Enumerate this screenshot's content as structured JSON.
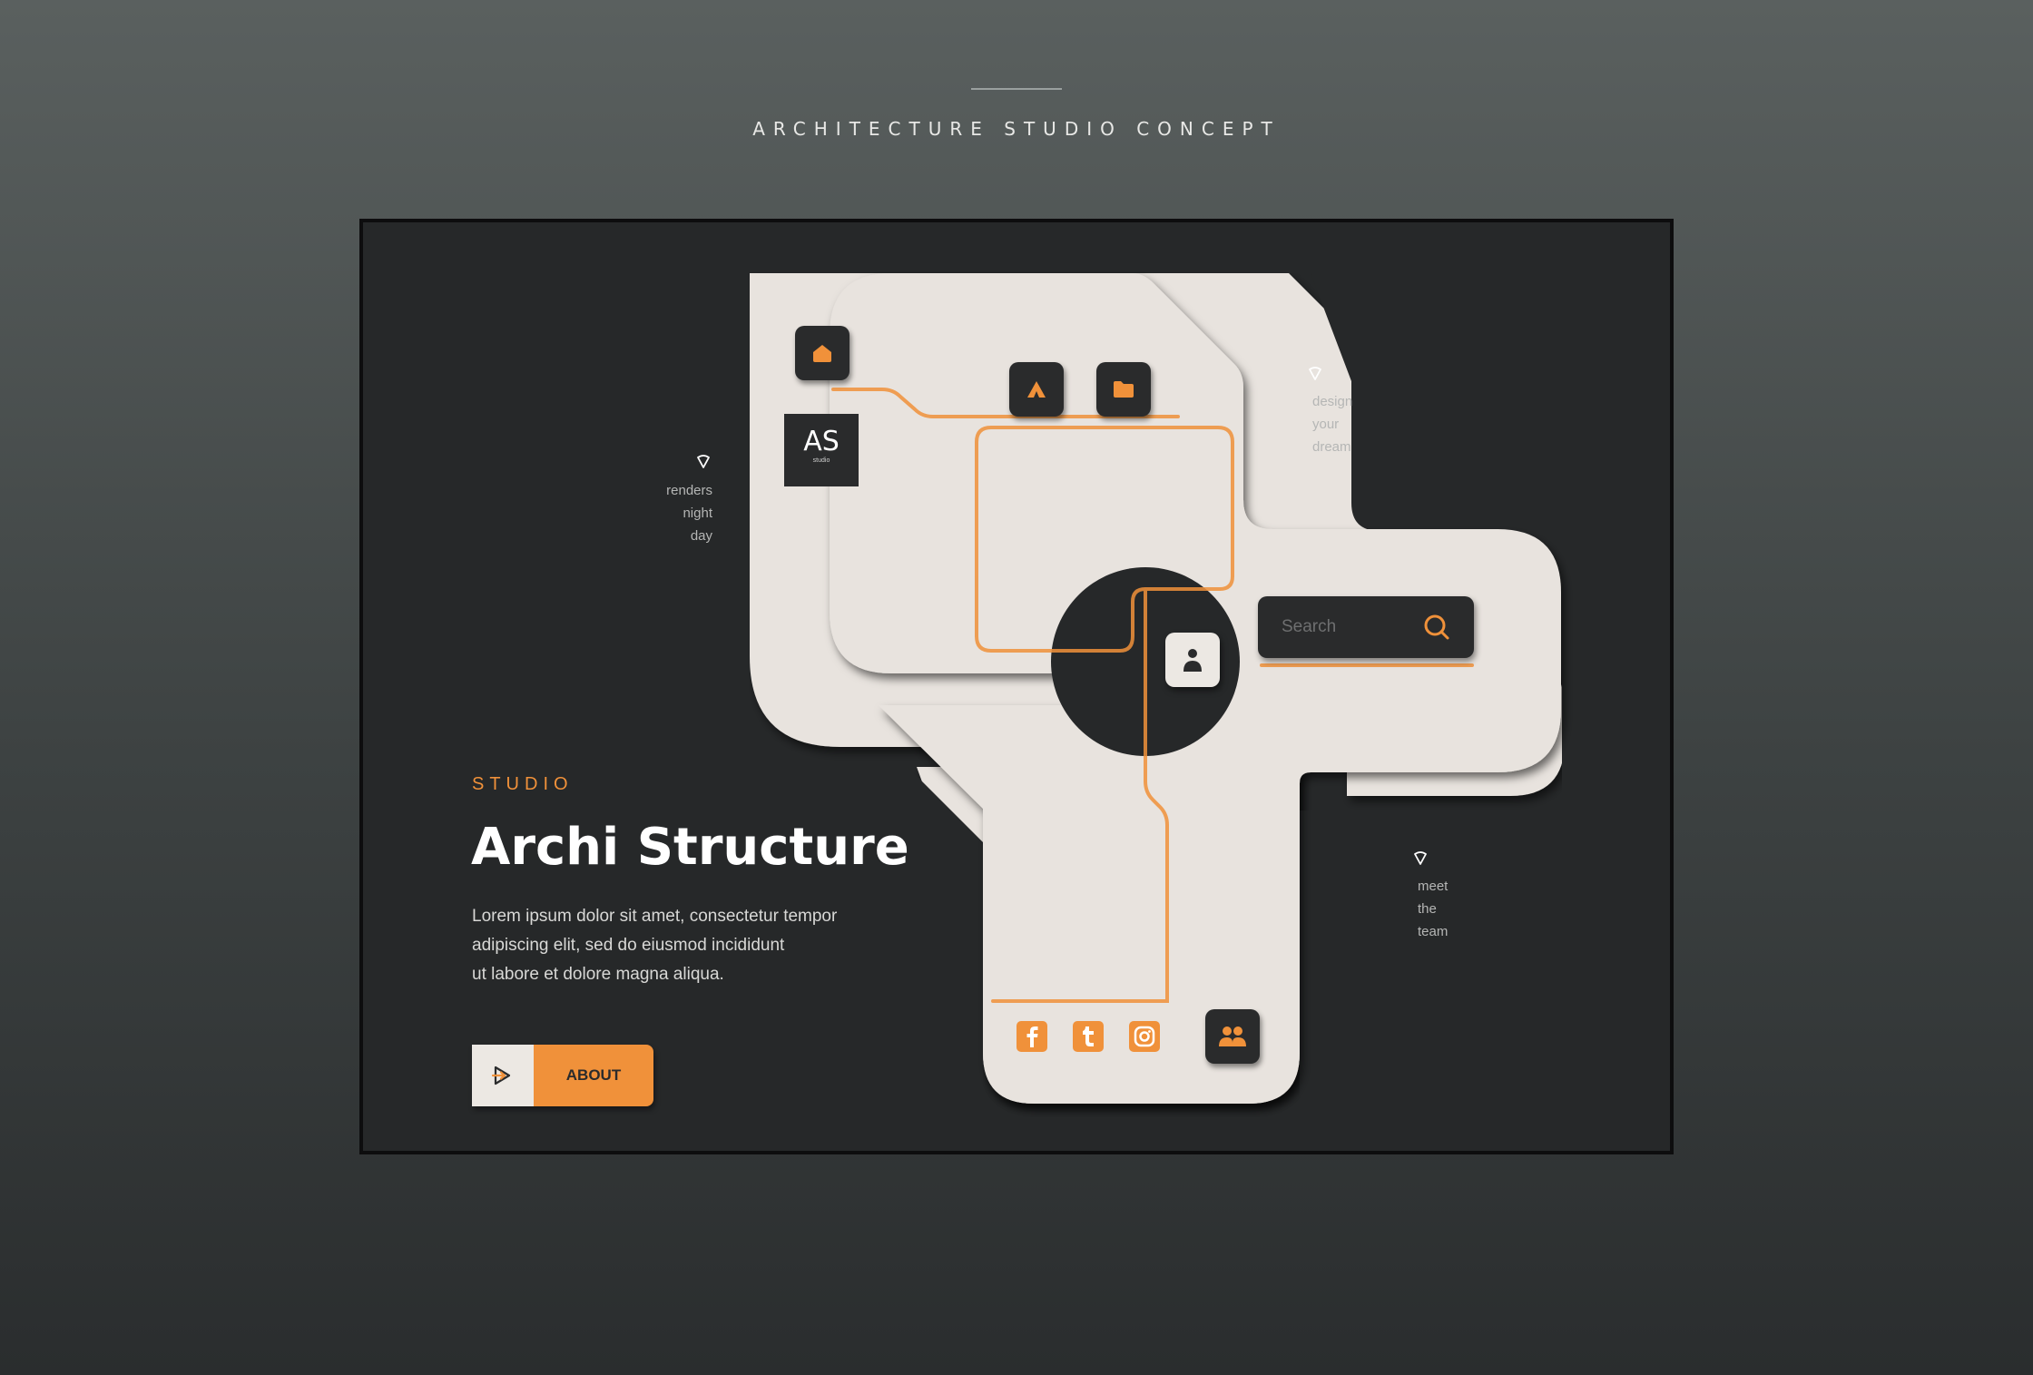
{
  "page": {
    "caption": "ARCHITECTURE STUDIO CONCEPT"
  },
  "colors": {
    "accent": "#f0913a",
    "panel": "#ece8e3",
    "dark": "#262829"
  },
  "logo": {
    "mark": "AS",
    "sub": "studio"
  },
  "toolbar": {
    "icons": [
      "home-icon",
      "tent-icon",
      "folder-icon",
      "user-icon",
      "team-icon"
    ]
  },
  "search": {
    "placeholder": "Search"
  },
  "notes": {
    "left": [
      "renders",
      "night",
      "day"
    ],
    "top_right": [
      "design",
      "your",
      "dream"
    ],
    "bottom_right": [
      "meet",
      "the",
      "team"
    ]
  },
  "hero": {
    "eyebrow": "STUDIO",
    "title": "Archi Structure",
    "body": [
      "Lorem ipsum dolor sit amet, consectetur tempor",
      "adipiscing elit, sed do eiusmod  incididunt",
      "ut labore et dolore magna aliqua."
    ],
    "button_label": "ABOUT"
  },
  "social": [
    "facebook-icon",
    "tumblr-icon",
    "instagram-icon"
  ]
}
